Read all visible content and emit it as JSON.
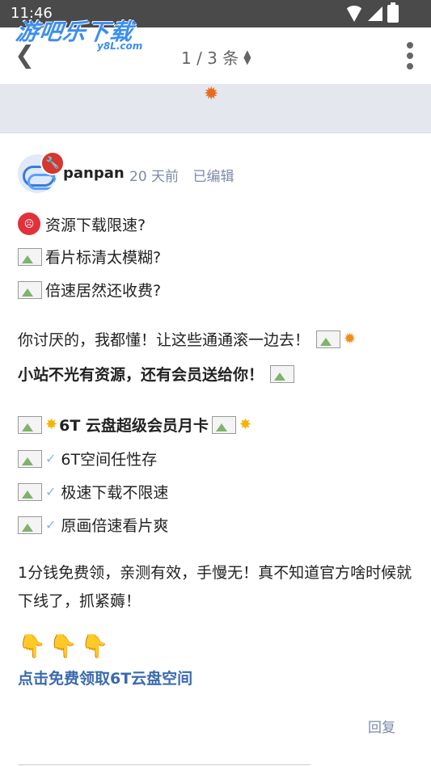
{
  "status_bar": {
    "time": "11:46"
  },
  "watermark": {
    "text": "游吧乐下载",
    "sub": "y8L.com"
  },
  "nav": {
    "back_icon": "back-chevron",
    "pager": "1 / 3 条",
    "sort_icon": "sort-updown",
    "more_icon": "more-vertical"
  },
  "banner": {
    "icon": "burst-icon"
  },
  "post": {
    "author": "panpan",
    "time_ago": "20 天前",
    "edited": "已编辑",
    "lines": [
      "资源下载限速?",
      "看片标清太模糊?",
      "倍速居然还收费?",
      "你讨厌的，我都懂！让这些通通滚一边去！",
      "小站不光有资源，还有会员送给你！",
      "6T 云盘超级会员月卡",
      "6T空间任性存",
      "极速下载不限速",
      "原画倍速看片爽"
    ],
    "paragraph": "1分钱免费领，亲测有效，手慢无！真不知道官方啥时候就下线了，抓紧薅！",
    "fingers": "👇👇👇",
    "link": "点击免费领取6T云盘空间",
    "reply": "回复"
  },
  "colors": {
    "accent": "#3a6ab0",
    "meta": "#7a8aa8",
    "badge": "#d4382f"
  }
}
